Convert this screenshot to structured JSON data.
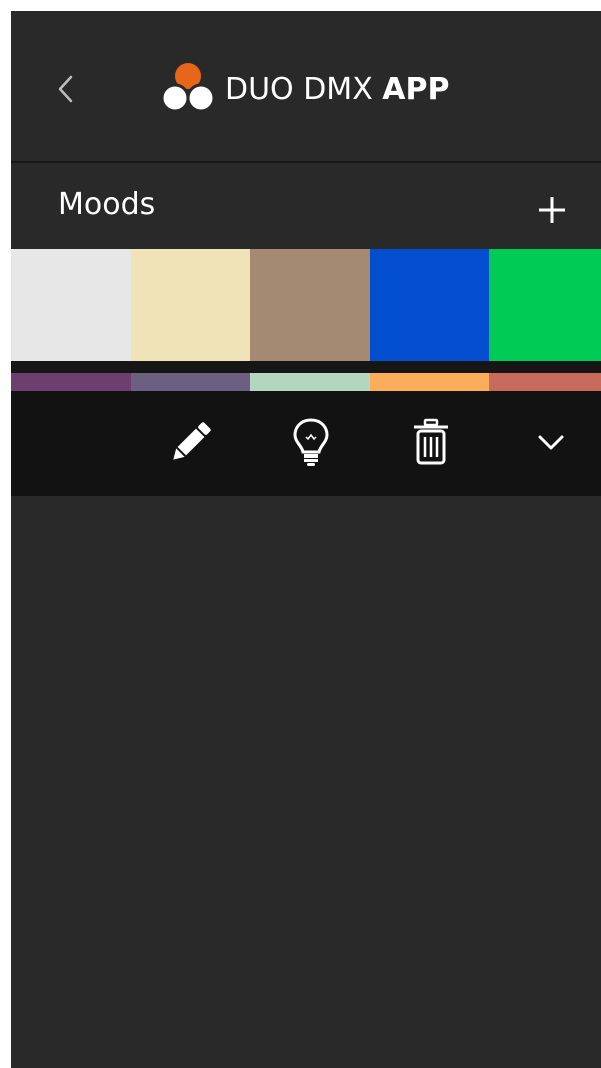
{
  "header": {
    "brand_light": "DUO DMX ",
    "brand_bold": "APP",
    "back_icon": "chevron-left-icon",
    "logo_icon": "three-circles-logo"
  },
  "moods": {
    "title": "Moods",
    "add_icon": "plus-icon"
  },
  "swatches": [
    "#e8e7e8",
    "#efe3b7",
    "#a48a73",
    "#034ecf",
    "#00cc55"
  ],
  "strip": [
    "#6d3e6f",
    "#6d5f82",
    "#b5d6be",
    "#fbad5c",
    "#c86a5c"
  ],
  "toolbar": {
    "icons": [
      "pencil-icon",
      "lightbulb-icon",
      "trash-icon",
      "chevron-down-icon"
    ]
  },
  "colors": {
    "background": "#292929",
    "toolbar": "#121212",
    "logo_accent": "#e8661a",
    "text": "#ffffff"
  }
}
